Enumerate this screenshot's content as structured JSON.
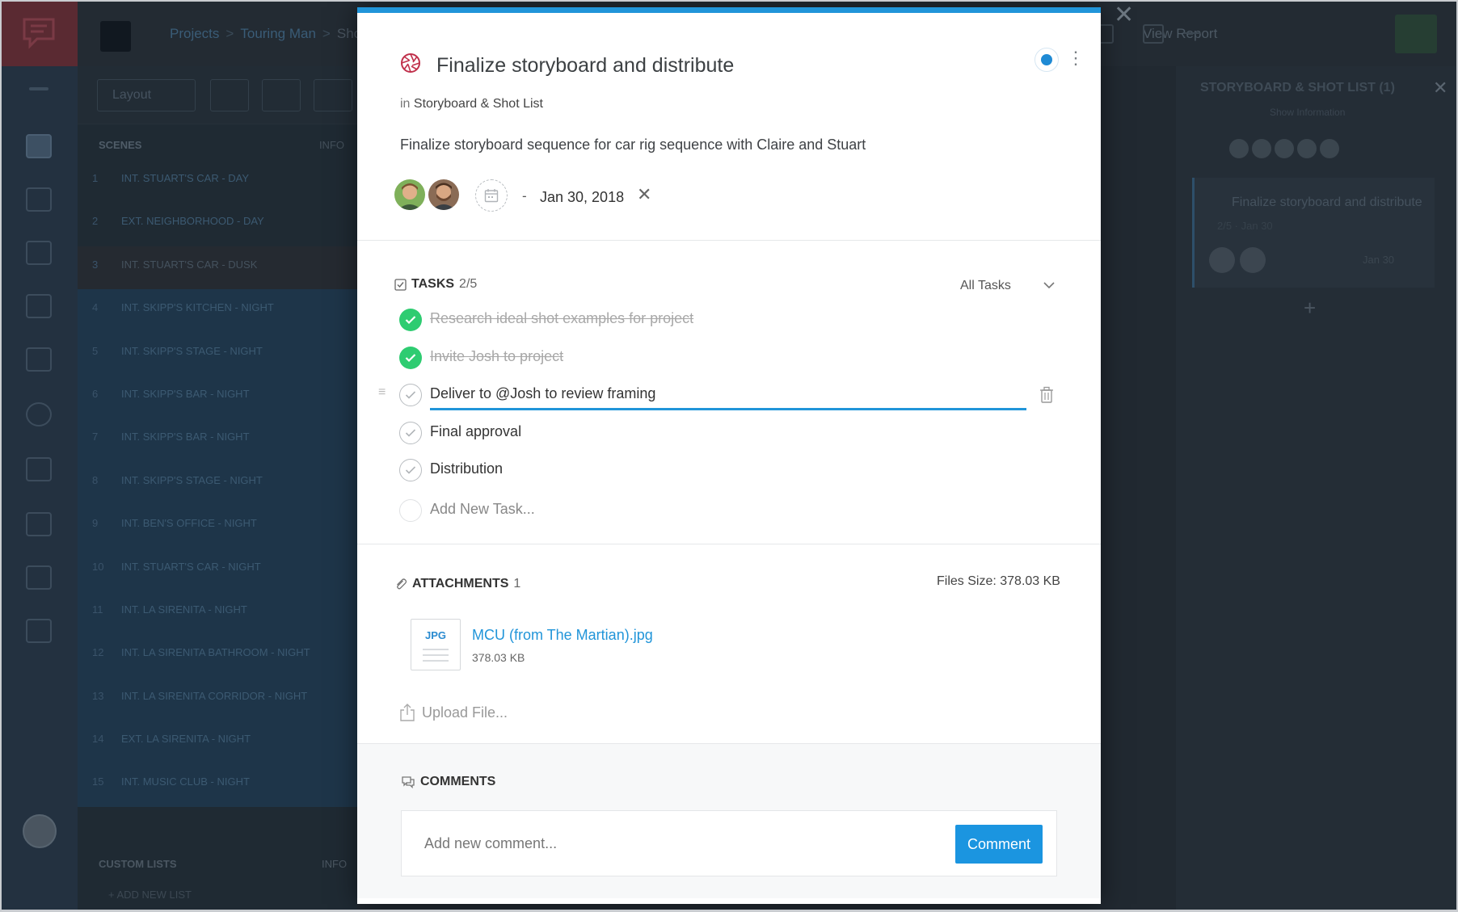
{
  "background": {
    "breadcrumbs": [
      "Projects",
      "Touring Man",
      "Shot"
    ],
    "view_report": "View Report",
    "layout_button": "Layout",
    "scenes_header": "SCENES",
    "scenes_header_right": "INFO",
    "scenes": [
      {
        "num": "1",
        "name": "INT. STUART'S CAR - DAY"
      },
      {
        "num": "2",
        "name": "EXT. NEIGHBORHOOD - DAY"
      },
      {
        "num": "3",
        "name": "INT. STUART'S CAR - DUSK"
      },
      {
        "num": "4",
        "name": "INT. SKIPP'S KITCHEN - NIGHT"
      },
      {
        "num": "5",
        "name": "INT. SKIPP'S STAGE - NIGHT"
      },
      {
        "num": "6",
        "name": "INT. SKIPP'S BAR - NIGHT"
      },
      {
        "num": "7",
        "name": "INT. SKIPP'S BAR - NIGHT"
      },
      {
        "num": "8",
        "name": "INT. SKIPP'S STAGE - NIGHT"
      },
      {
        "num": "9",
        "name": "INT. BEN'S OFFICE - NIGHT"
      },
      {
        "num": "10",
        "name": "INT. STUART'S CAR - NIGHT"
      },
      {
        "num": "11",
        "name": "INT. LA SIRENITA - NIGHT"
      },
      {
        "num": "12",
        "name": "INT. LA SIRENITA BATHROOM - NIGHT"
      },
      {
        "num": "13",
        "name": "INT. LA SIRENITA CORRIDOR - NIGHT"
      },
      {
        "num": "14",
        "name": "EXT. LA SIRENITA - NIGHT"
      },
      {
        "num": "15",
        "name": "INT. MUSIC CLUB - NIGHT"
      }
    ],
    "custom_lists": "CUSTOM LISTS",
    "custom_lists_right": "INFO",
    "add_list": "+ ADD NEW LIST",
    "right_panel_title": "STORYBOARD & SHOT LIST (1)",
    "right_panel_sub": "Show Information",
    "right_card_title": "Finalize storyboard and distribute",
    "right_card_date": "2/5 · Jan 30",
    "right_card_date2": "Jan 30"
  },
  "modal": {
    "title": "Finalize storyboard and distribute",
    "in_prefix": "in",
    "list_name": "Storyboard & Shot List",
    "description": "Finalize storyboard sequence for car rig sequence with Claire and Stuart",
    "date_dash": "-",
    "due_date": "Jan 30, 2018",
    "tasks_label": "TASKS",
    "tasks_count": "2/5",
    "filter": "All Tasks",
    "tasks": [
      {
        "label": "Research ideal shot examples for project",
        "done": true
      },
      {
        "label": "Invite Josh to project",
        "done": true
      },
      {
        "label": "Deliver to @Josh to review framing",
        "done": false
      },
      {
        "label": "Final approval",
        "done": false
      },
      {
        "label": "Distribution",
        "done": false
      }
    ],
    "new_task_placeholder": "Add New Task...",
    "attachments_label": "ATTACHMENTS",
    "attachments_count": "1",
    "files_size": "Files Size: 378.03 KB",
    "file": {
      "ext": "JPG",
      "name": "MCU (from The Martian).jpg",
      "size": "378.03 KB"
    },
    "upload_label": "Upload File...",
    "comments_label": "COMMENTS",
    "comment_placeholder": "Add new comment...",
    "comment_button": "Comment"
  },
  "colors": {
    "accent": "#2195d9",
    "done": "#2ecc71",
    "status": "#1f8ad4"
  },
  "icons": [
    "app-logo-icon",
    "storyboard-icon",
    "calendar-icon",
    "checkbox-icon",
    "paperclip-icon",
    "comment-icon",
    "trash-icon",
    "upload-icon",
    "chevron-down-icon",
    "close-icon",
    "kebab-menu-icon",
    "drag-handle-icon"
  ]
}
